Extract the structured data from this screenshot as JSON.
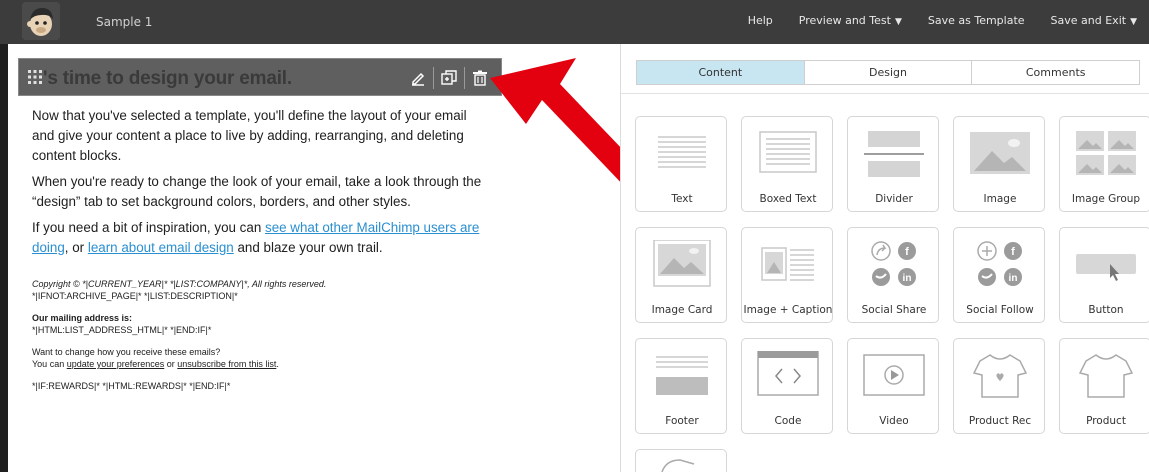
{
  "app": {
    "doc_title": "Sample 1",
    "nav": {
      "help": "Help",
      "preview": "Preview and Test",
      "save_template": "Save as Template",
      "save_exit": "Save and Exit"
    }
  },
  "preview": {
    "block_heading": "'s time to design your email.",
    "para1": "Now that you've selected a template, you'll define the layout of your email and give your content a place to live by adding, rearranging, and deleting content blocks.",
    "para2": "When you're ready to change the look of your email, take a look through the “design” tab to set background colors, borders, and other styles.",
    "para3_pre": "If you need a bit of inspiration, you can ",
    "para3_link1": "see what other MailChimp users are doing",
    "para3_mid": ", or ",
    "para3_link2": "learn about email design",
    "para3_post": " and blaze your own trail.",
    "copyright": "Copyright © *|CURRENT_YEAR|* *|LIST:COMPANY|*, All rights reserved.",
    "archive": "*|IFNOT:ARCHIVE_PAGE|* *|LIST:DESCRIPTION|*",
    "address_heading": "Our mailing address is:",
    "address": "*|HTML:LIST_ADDRESS_HTML|* *|END:IF|*",
    "change_q": "Want to change how you receive these emails?",
    "change_pre": "You can ",
    "update_link": "update your preferences",
    "change_mid": " or ",
    "unsub_link": "unsubscribe from this list",
    "change_post": ".",
    "rewards": "*|IF:REWARDS|* *|HTML:REWARDS|* *|END:IF|*"
  },
  "tabs": [
    "Content",
    "Design",
    "Comments"
  ],
  "blocks": [
    {
      "label": "Text",
      "icon": "text-block-icon"
    },
    {
      "label": "Boxed Text",
      "icon": "boxed-text-block-icon"
    },
    {
      "label": "Divider",
      "icon": "divider-block-icon"
    },
    {
      "label": "Image",
      "icon": "image-block-icon"
    },
    {
      "label": "Image Group",
      "icon": "image-group-block-icon"
    },
    {
      "label": "Image Card",
      "icon": "image-card-block-icon"
    },
    {
      "label": "Image + Caption",
      "icon": "image-caption-block-icon"
    },
    {
      "label": "Social Share",
      "icon": "social-share-block-icon"
    },
    {
      "label": "Social Follow",
      "icon": "social-follow-block-icon"
    },
    {
      "label": "Button",
      "icon": "button-block-icon"
    },
    {
      "label": "Footer",
      "icon": "footer-block-icon"
    },
    {
      "label": "Code",
      "icon": "code-block-icon"
    },
    {
      "label": "Video",
      "icon": "video-block-icon"
    },
    {
      "label": "Product Rec",
      "icon": "product-rec-block-icon"
    },
    {
      "label": "Product",
      "icon": "product-block-icon"
    }
  ],
  "colors": {
    "topbar": "#3c3c3c",
    "active_tab": "#c7e6f1",
    "link": "#2a8fd1",
    "arrow": "#e3000f"
  }
}
